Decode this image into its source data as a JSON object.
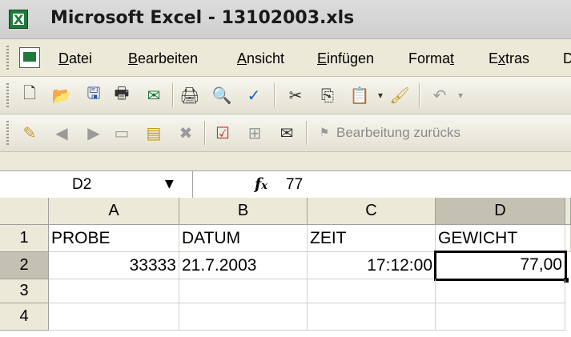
{
  "window": {
    "title": "Microsoft Excel - 13102003.xls",
    "app_icon": "excel-app-icon"
  },
  "menu": {
    "items": [
      {
        "pre": "",
        "u": "D",
        "post": "atei"
      },
      {
        "pre": "",
        "u": "B",
        "post": "earbeiten"
      },
      {
        "pre": "",
        "u": "A",
        "post": "nsicht"
      },
      {
        "pre": "",
        "u": "E",
        "post": "infügen"
      },
      {
        "pre": "Forma",
        "u": "t",
        "post": ""
      },
      {
        "pre": "E",
        "u": "x",
        "post": "tras"
      },
      {
        "pre": "",
        "u": "",
        "post": "D"
      }
    ]
  },
  "toolbar2": {
    "text": "Bearbeitung zurücks"
  },
  "formula": {
    "namebox": "D2",
    "fx": "fx",
    "value": "77"
  },
  "sheet": {
    "columns": [
      "A",
      "B",
      "C",
      "D"
    ],
    "rows": [
      "1",
      "2",
      "3",
      "4"
    ],
    "cells": {
      "A1": "PROBE",
      "B1": "DATUM",
      "C1": "ZEIT",
      "D1": "GEWICHT",
      "A2": "33333",
      "B2": "21.7.2003",
      "C2": "17:12:00",
      "D2": "77,00"
    },
    "active_cell": "D2"
  },
  "colors": {
    "excel_green": "#1f7a3c",
    "header_bg": "#ece9d8",
    "active_header": "#c4c1b3"
  }
}
